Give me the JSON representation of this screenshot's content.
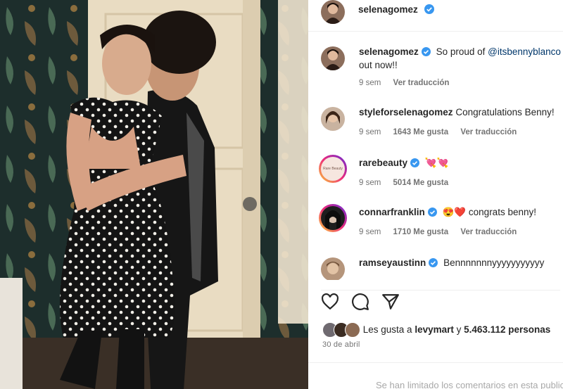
{
  "post": {
    "author": "selenagomez",
    "caption_author": "selenagomez",
    "caption_text": "So proud of ",
    "caption_mention": "@itsbennyblanco",
    "caption_text_2": "out now!!",
    "caption_time": "9 sem",
    "caption_translate": "Ver traducción"
  },
  "comments": [
    {
      "user": "styleforselenagomez",
      "verified": false,
      "text": "Congratulations Benny!",
      "time": "9 sem",
      "likes": "1643 Me gusta",
      "translate": "Ver traducción",
      "avatar_color": "#c9b3a0"
    },
    {
      "user": "rarebeauty",
      "verified": true,
      "text": "💘💘",
      "time": "9 sem",
      "likes": "5014 Me gusta",
      "translate": "",
      "avatar_color": "#f6e6df",
      "avatar_text": "Rare Beauty"
    },
    {
      "user": "connarfranklin",
      "verified": true,
      "text": "😍❤️ congrats benny!",
      "time": "9 sem",
      "likes": "1710 Me gusta",
      "translate": "Ver traducción",
      "avatar_color": "#1e1e1e"
    },
    {
      "user": "ramseyaustinn",
      "verified": true,
      "text": "Bennnnnnnyyyyyyyyyyy",
      "time": "",
      "likes": "",
      "translate": "",
      "avatar_color": "#b5957b"
    }
  ],
  "likes_summary": {
    "prefix": "Les gusta a ",
    "user": "levymart",
    "conj": " y ",
    "count": "5.463.112 personas"
  },
  "date": "30 de abril",
  "footer": "Se han limitado los comentarios en esta publicación.",
  "icons": [
    "heart-icon",
    "comment-icon",
    "share-icon",
    "verified-icon"
  ],
  "colors": {
    "verified": "#3897f0",
    "link": "#00376b",
    "muted": "#737373"
  }
}
